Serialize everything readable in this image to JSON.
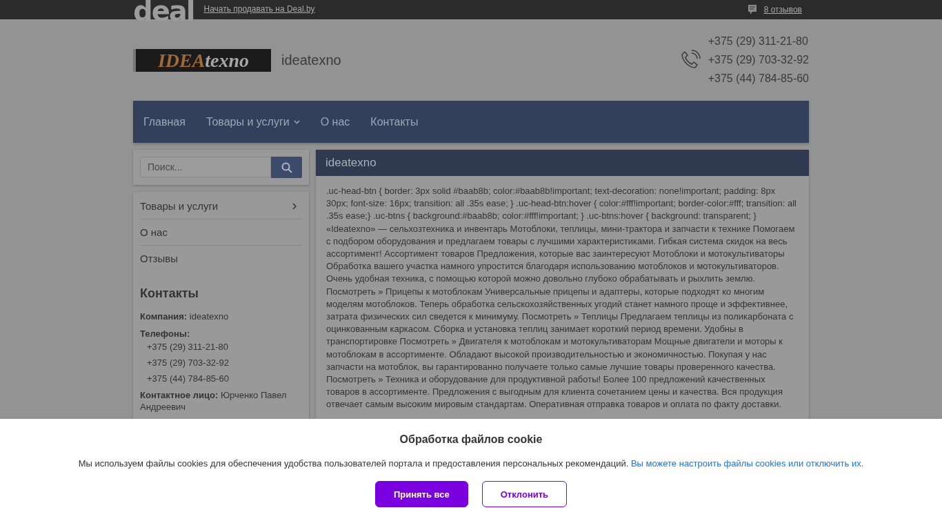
{
  "top_bar": {
    "logo": "deal",
    "sell_link": "Начать продавать на Deal.by",
    "reviews_link": "8 отзывов"
  },
  "header": {
    "logo_part_1": "IDEA",
    "logo_part_2": "texno",
    "company_name": "ideatexno",
    "phones": [
      "+375 (29) 311-21-80",
      "+375 (29) 703-32-92",
      "+375 (44) 784-85-60"
    ]
  },
  "nav": {
    "items": [
      {
        "label": "Главная",
        "dropdown": false
      },
      {
        "label": "Товары и услуги",
        "dropdown": true
      },
      {
        "label": "О нас",
        "dropdown": false
      },
      {
        "label": "Контакты",
        "dropdown": false
      }
    ]
  },
  "sidebar": {
    "search": {
      "placeholder": "Поиск..."
    },
    "menu": [
      {
        "label": "Товары и услуги",
        "submenu": true
      },
      {
        "label": "О нас",
        "submenu": false
      },
      {
        "label": "Отзывы",
        "submenu": false
      }
    ],
    "contacts": {
      "title": "Контакты",
      "company_label": "Компания:",
      "company": "ideatexno",
      "phones_label": "Телефоны:",
      "phones": [
        "+375 (29) 311-21-80",
        "+375 (29) 703-32-92",
        "+375 (44) 784-85-60"
      ],
      "person_label": "Контактное лицо:",
      "person": "Юрченко Павел Андреевич"
    }
  },
  "main": {
    "title": "ideatexno",
    "text": ".uc-head-btn { border: 3px solid #baab8b; color:#baab8b!important; text-decoration: none!important; padding: 8px 30px; font-size: 16px; transition: all .35s ease; } .uc-head-btn:hover { color:#fff!important; border-color:#fff; transition: all .35s ease;} .uc-btns { background:#baab8b; color:#fff!important; } .uc-btns:hover { background: transparent; } «Ideatexno» — сельхозтехника и инвентарь Мотоблоки, теплицы, мини-трактора и запчасти к технике Помогаем с подбором оборудования и предлагаем товары с лучшими характеристиками. Гибкая система скидок на весь ассортимент! Ассортимент товаров Предложения, которые вас заинтересуют Мотоблоки и мотокультиваторы Обработка вашего участка намного упростится благодаря использованию мотоблоков и мотокультиваторов. Очень удобная техника, с помощью которой можно довольно глубоко обрабатывать и рыхлить землю. Посмотреть » Прицепы к мотоблокам Универсальные прицепы и адаптеры, которые подходят ко многим моделям мотоблоков. Теперь обработка сельскохозяйственных угодий станет намного проще и эффективнее, затрата физических сил сведется к минимуму. Посмотреть » Теплицы Предлагаем теплицы из поликарбоната с оцинкованным каркасом. Сборка и установка теплиц занимает короткий период времени. Удобны в транспортировке Посмотреть » Двигателя к мотоблокам и мотокультиваторам Мощные двигатели и моторы к мотоблокам в ассортименте. Обладают высокой производительностью и экономичностью. Покупая у нас запчасти на мотоблок, вы гарантированно получаете только самые лучшие товары проверенного качества. Посмотреть » Техника и оборудование для продуктивной работы! Более 100 предложений качественных товаров в ассортименте. Предложения с выгодным для клиента сочетанием цены и качества. Вся продукция отвечает самым высоким мировым стандартам. Оперативная отправка товаров и оплата по факту доставки."
  },
  "cookie_banner": {
    "title": "Обработка файлов cookie",
    "text": "Мы используем файлы cookies для обеспечения удобства пользователей портала и предоставления персональных рекомендаций.",
    "link": "Вы можете настроить файлы cookies или отключить их.",
    "buttons": [
      {
        "label": "Принять все",
        "kind": "primary"
      },
      {
        "label": "Отклонить",
        "kind": "secondary"
      }
    ]
  }
}
